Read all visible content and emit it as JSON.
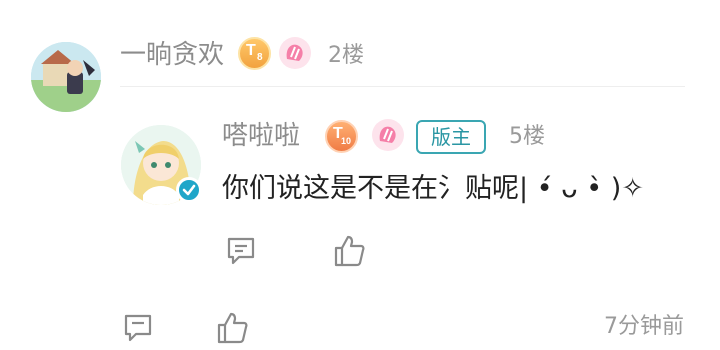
{
  "reply": {
    "username": "一晌贪欢",
    "level_badge": "T8",
    "floor": "2楼",
    "time": "7分钟前"
  },
  "sub_reply": {
    "username": "嗒啦啦",
    "level_badge": "T10",
    "role_badge": "版主",
    "floor": "5楼",
    "content": "你们说这是不是在氵贴呢| •́ ᴗ •̀ )✧"
  },
  "icons": {
    "comment": "comment-icon",
    "like": "thumbs-up-icon",
    "fan": "fan-badge-icon",
    "verified": "verified-check-icon"
  },
  "colors": {
    "accent": "#3aa6b2",
    "name_gray": "#8c8c8c",
    "level_gold": "#f2a23e",
    "level_orange": "#f07c45",
    "fan_pink": "#f57fa8"
  }
}
